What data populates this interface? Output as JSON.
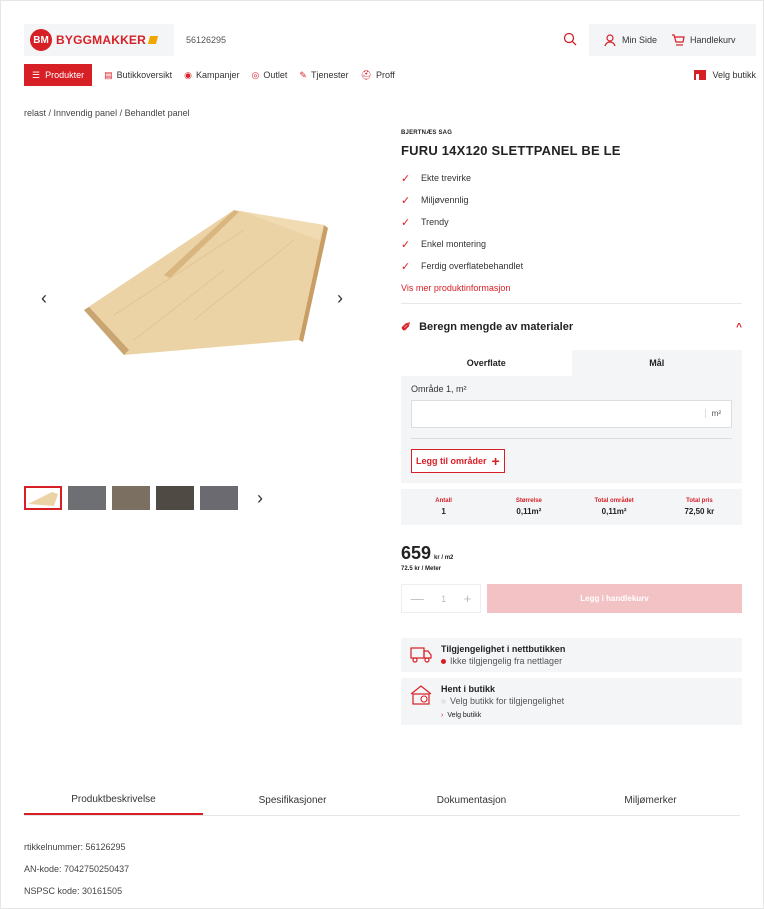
{
  "header": {
    "logo_badge": "BM",
    "logo_text": "BYGGMAKKER",
    "search_value": "56126295",
    "min_side": "Min Side",
    "cart": "Handlekurv"
  },
  "nav": {
    "products": "Produkter",
    "items": [
      "Butikkoversikt",
      "Kampanjer",
      "Outlet",
      "Tjenester",
      "Proff"
    ],
    "store": "Velg butikk"
  },
  "breadcrumb": "relast / Innvendig panel / Behandlet panel",
  "product": {
    "brand": "BJERTNÆS SAG",
    "title": "FURU 14X120 SLETTPANEL BE LE",
    "features": [
      "Ekte trevirke",
      "Miljøvennlig",
      "Trendy",
      "Enkel montering",
      "Ferdig overflatebehandlet"
    ],
    "more_info": "Vis mer produktinformasjon"
  },
  "calculator": {
    "title": "Beregn mengde av materialer",
    "tabs": [
      "Overflate",
      "Mål"
    ],
    "area_label": "Område 1, m²",
    "unit": "m²",
    "add_area": "Legg til områder",
    "summary": [
      {
        "key": "Antall",
        "value": "1"
      },
      {
        "key": "Størrelse",
        "value": "0,11m²"
      },
      {
        "key": "Total området",
        "value": "0,11m²"
      },
      {
        "key": "Total pris",
        "value": "72,50 kr"
      }
    ]
  },
  "price": {
    "amount": "659",
    "unit": "kr / m2",
    "per_meter": "72.5 kr / Meter"
  },
  "buy": {
    "qty": "1",
    "cart_button": "Legg i handlekurv"
  },
  "availability": {
    "online_title": "Tilgjengelighet i nettbutikken",
    "online_status": "Ikke tilgjengelig fra nettlager",
    "store_title": "Hent i butikk",
    "store_status": "Velg butikk for tilgjengelighet",
    "choose_store": "Velg butikk",
    "online_dot_color": "#d71f26",
    "store_dot_color": "#e5e5e5"
  },
  "tabs": [
    "Produktbeskrivelse",
    "Spesifikasjoner",
    "Dokumentasjon",
    "Miljømerker"
  ],
  "specs": [
    "rtikkelnummer: 56126295",
    "AN-kode: 7042750250437",
    "NSPSC kode: 30161505"
  ],
  "colors": {
    "accent": "#d71f26",
    "panel": "#f4f5f7"
  }
}
